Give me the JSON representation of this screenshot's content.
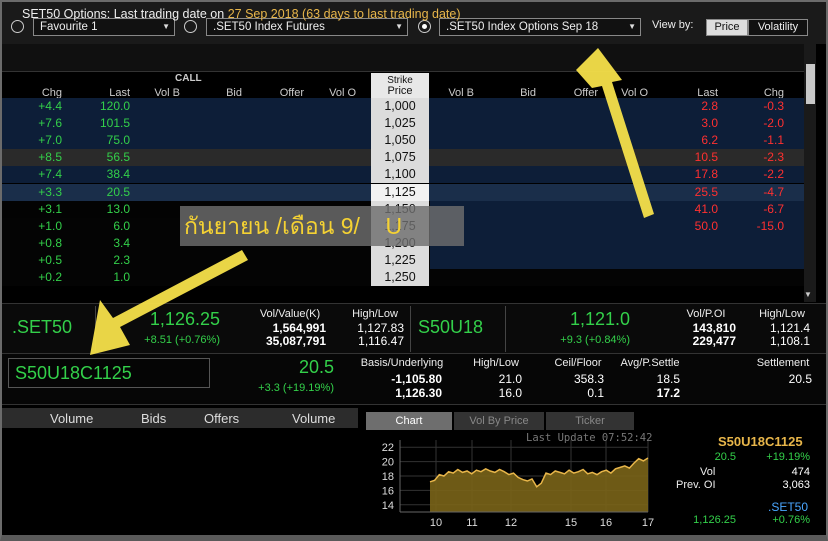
{
  "toolbar": {
    "favourite_label": "Favourite 1",
    "futures_label": ".SET50 Index Futures",
    "options_label": ".SET50 Index Options Sep 18",
    "view_by_label": "View by:",
    "price_button": "Price",
    "volatility_button": "Volatility"
  },
  "info": {
    "prefix": "SET50 Options: Last trading date on ",
    "highlight": "27 Sep 2018 (63 days to last trading date)"
  },
  "table": {
    "call_label": "CALL",
    "strike_label_1": "Strike",
    "strike_label_2": "Price",
    "call_headers": [
      "Chg",
      "Last",
      "Vol B",
      "Bid",
      "Offer",
      "Vol O"
    ],
    "put_headers": [
      "Vol B",
      "Bid",
      "Offer",
      "Vol O",
      "Last",
      "Chg"
    ],
    "rows": [
      {
        "call_chg": "+4.4",
        "call_last": "120.0",
        "strike": "1,000",
        "put_last": "2.8",
        "put_chg": "-0.3"
      },
      {
        "call_chg": "+7.6",
        "call_last": "101.5",
        "strike": "1,025",
        "put_last": "3.0",
        "put_chg": "-2.0"
      },
      {
        "call_chg": "+7.0",
        "call_last": "75.0",
        "strike": "1,050",
        "put_last": "6.2",
        "put_chg": "-1.1"
      },
      {
        "call_chg": "+8.5",
        "call_last": "56.5",
        "strike": "1,075",
        "put_last": "10.5",
        "put_chg": "-2.3"
      },
      {
        "call_chg": "+7.4",
        "call_last": "38.4",
        "strike": "1,100",
        "put_last": "17.8",
        "put_chg": "-2.2"
      },
      {
        "call_chg": "+3.3",
        "call_last": "20.5",
        "strike": "1,125",
        "put_last": "25.5",
        "put_chg": "-4.7"
      },
      {
        "call_chg": "+3.1",
        "call_last": "13.0",
        "strike": "1,150",
        "put_last": "41.0",
        "put_chg": "-6.7"
      },
      {
        "call_chg": "+1.0",
        "call_last": "6.0",
        "strike": "1,175",
        "put_last": "50.0",
        "put_chg": "-15.0"
      },
      {
        "call_chg": "+0.8",
        "call_last": "3.4",
        "strike": "1,200",
        "put_last": "",
        "put_chg": ""
      },
      {
        "call_chg": "+0.5",
        "call_last": "2.3",
        "strike": "1,225",
        "put_last": "",
        "put_chg": ""
      },
      {
        "call_chg": "+0.2",
        "call_last": "1.0",
        "strike": "1,250",
        "put_last": "",
        "put_chg": ""
      }
    ]
  },
  "annotation": {
    "text": "กันยายน /เดือน 9/    U"
  },
  "set50_panel": {
    "name": ".SET50",
    "price": "1,126.25",
    "change": "+8.51 (+0.76%)",
    "vol_value_label": "Vol/Value(K)",
    "volume": "1,564,991",
    "value": "35,087,791",
    "high_low_label": "High/Low",
    "high": "1,127.83",
    "low": "1,116.47"
  },
  "futures_panel": {
    "name": "S50U18",
    "price": "1,121.0",
    "change": "+9.3 (+0.84%)",
    "vol_poi_label": "Vol/P.OI",
    "volume": "143,810",
    "poi": "229,477",
    "high_low_label": "High/Low",
    "high": "1,121.4",
    "low": "1,108.1"
  },
  "option_panel": {
    "symbol": "S50U18C1125",
    "price": "20.5",
    "change": "+3.3 (+19.19%)",
    "basis_label": "Basis/Underlying",
    "basis": "-1,105.80",
    "underlying": "1,126.30",
    "high_low_label": "High/Low",
    "high": "21.0",
    "low": "16.0",
    "ceil_floor_label": "Ceil/Floor",
    "ceil": "358.3",
    "floor": "0.1",
    "avg_settle_label": "Avg/P.Settle",
    "avg": "18.5",
    "p_settle": "17.2",
    "settlement_label": "Settlement",
    "settlement": "20.5"
  },
  "orderbook": {
    "volume_label": "Volume",
    "bids_label": "Bids",
    "offers_label": "Offers",
    "volume_label_2": "Volume"
  },
  "tabs": {
    "chart": "Chart",
    "vol_by_price": "Vol By Price",
    "ticker": "Ticker"
  },
  "chart_info": {
    "last_update": "Last Update 07:52:42",
    "symbol": "S50U18C1125",
    "price": "20.5",
    "pct": "+19.19%",
    "vol_label": "Vol",
    "vol": "474",
    "prev_oi_label": "Prev. OI",
    "prev_oi": "3,063",
    "index_name": ".SET50",
    "index_price": "1,126.25",
    "index_pct": "+0.76%"
  },
  "chart_data": {
    "type": "area",
    "x_ticks": [
      "10",
      "11",
      "12",
      "15",
      "16",
      "17"
    ],
    "y_ticks": [
      "22",
      "20",
      "18",
      "16",
      "14"
    ],
    "ylim": [
      13,
      23
    ],
    "values": [
      17.2,
      17.4,
      18.2,
      18.0,
      18.6,
      18.4,
      18.9,
      18.5,
      18.7,
      18.3,
      18.8,
      18.6,
      19.0,
      18.7,
      18.5,
      18.9,
      18.6,
      18.2,
      18.4,
      17.8,
      17.5,
      17.3,
      17.6,
      16.5,
      17.0,
      18.4,
      18.2,
      18.7,
      18.5,
      18.3,
      18.8,
      18.4,
      18.6,
      18.9,
      18.3,
      18.5,
      18.2,
      18.6,
      18.8,
      18.4,
      19.0,
      19.2,
      19.4,
      19.1,
      19.8,
      20.4,
      20.1,
      20.5
    ]
  }
}
